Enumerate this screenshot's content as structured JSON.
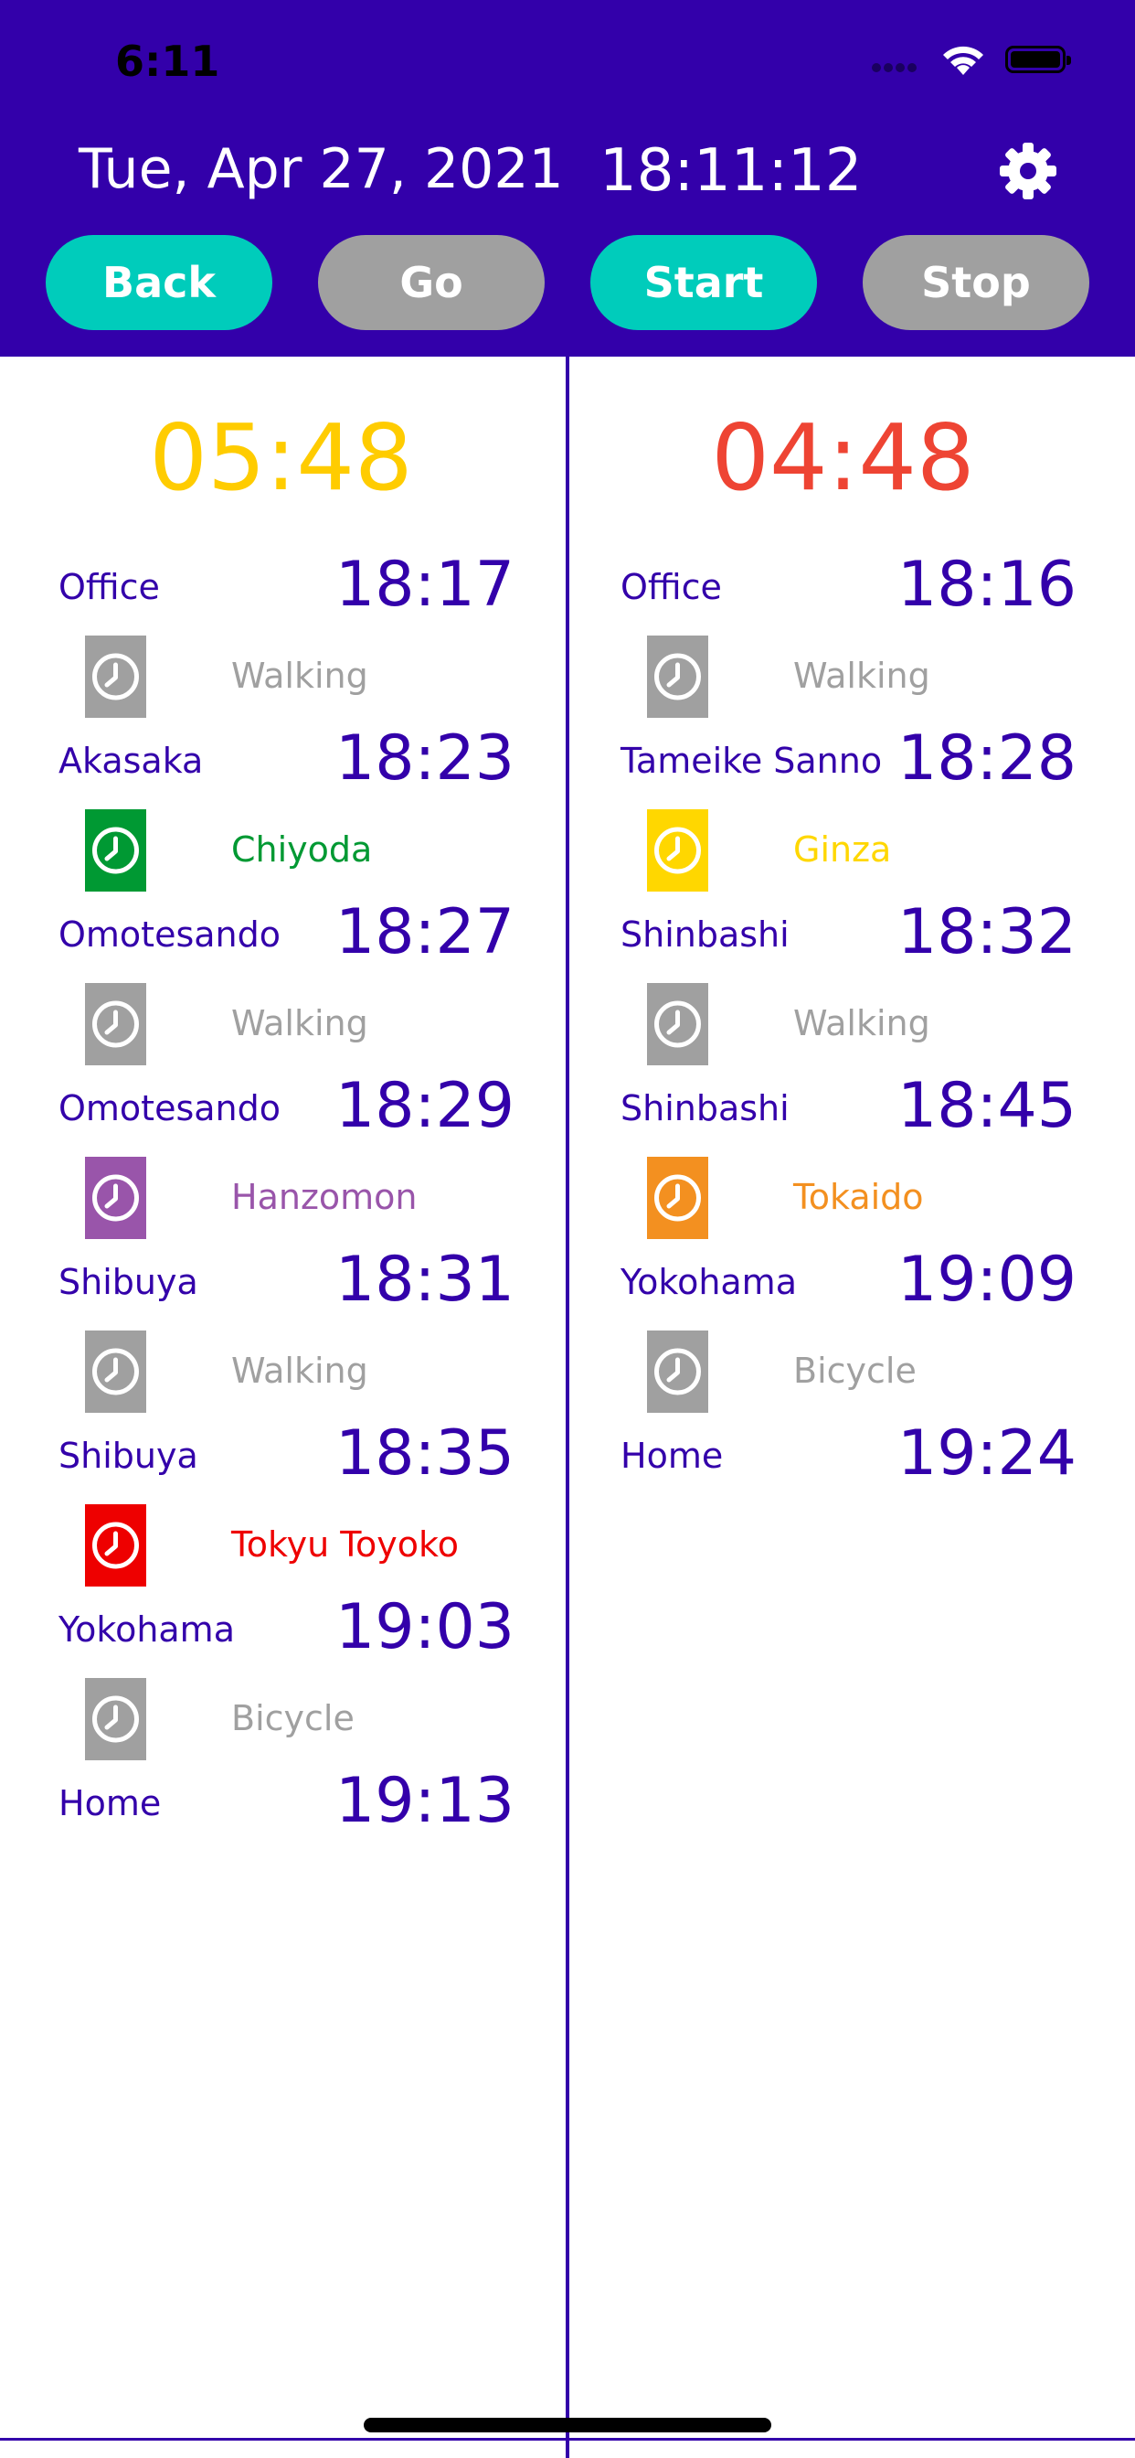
{
  "status_bar": {
    "time": "6:11"
  },
  "header": {
    "date": "Tue, Apr 27, 2021",
    "clock": "18:11:12",
    "settings_icon": "gear-icon",
    "buttons": [
      {
        "label": "Back",
        "color": "#00CCBB"
      },
      {
        "label": "Go",
        "color": "#A0A0A0"
      },
      {
        "label": "Start",
        "color": "#00CCBB"
      },
      {
        "label": "Stop",
        "color": "#A0A0A0"
      }
    ]
  },
  "colors": {
    "primary": "#3300AA",
    "walking": "#A0A0A0"
  },
  "routes": [
    {
      "countdown": "05:48",
      "countdown_color": "#FFCC00",
      "stops": [
        {
          "name": "Office",
          "time": "18:17"
        },
        {
          "name": "Akasaka",
          "time": "18:23"
        },
        {
          "name": "Omotesando",
          "time": "18:27"
        },
        {
          "name": "Omotesando",
          "time": "18:29"
        },
        {
          "name": "Shibuya",
          "time": "18:31"
        },
        {
          "name": "Shibuya",
          "time": "18:35"
        },
        {
          "name": "Yokohama",
          "time": "19:03"
        },
        {
          "name": "Home",
          "time": "19:13"
        }
      ],
      "legs": [
        {
          "label": "Walking",
          "color": "#A0A0A0",
          "icon": "clock-icon"
        },
        {
          "label": "Chiyoda",
          "color": "#009933",
          "icon": "clock-icon"
        },
        {
          "label": "Walking",
          "color": "#A0A0A0",
          "icon": "clock-icon"
        },
        {
          "label": "Hanzomon",
          "color": "#9955AA",
          "icon": "clock-icon"
        },
        {
          "label": "Walking",
          "color": "#A0A0A0",
          "icon": "clock-icon"
        },
        {
          "label": "Tokyu Toyoko",
          "color": "#EE0000",
          "icon": "clock-icon"
        },
        {
          "label": "Bicycle",
          "color": "#A0A0A0",
          "icon": "clock-icon"
        }
      ]
    },
    {
      "countdown": "04:48",
      "countdown_color": "#EE4433",
      "stops": [
        {
          "name": "Office",
          "time": "18:16"
        },
        {
          "name": "Tameike Sanno",
          "time": "18:28"
        },
        {
          "name": "Shinbashi",
          "time": "18:32"
        },
        {
          "name": "Shinbashi",
          "time": "18:45"
        },
        {
          "name": "Yokohama",
          "time": "19:09"
        },
        {
          "name": "Home",
          "time": "19:24"
        }
      ],
      "legs": [
        {
          "label": "Walking",
          "color": "#A0A0A0",
          "icon": "clock-icon"
        },
        {
          "label": "Ginza",
          "color": "#FFD700",
          "icon": "clock-icon"
        },
        {
          "label": "Walking",
          "color": "#A0A0A0",
          "icon": "clock-icon"
        },
        {
          "label": "Tokaido",
          "color": "#F39020",
          "icon": "clock-icon"
        },
        {
          "label": "Bicycle",
          "color": "#A0A0A0",
          "icon": "clock-icon"
        }
      ]
    }
  ]
}
